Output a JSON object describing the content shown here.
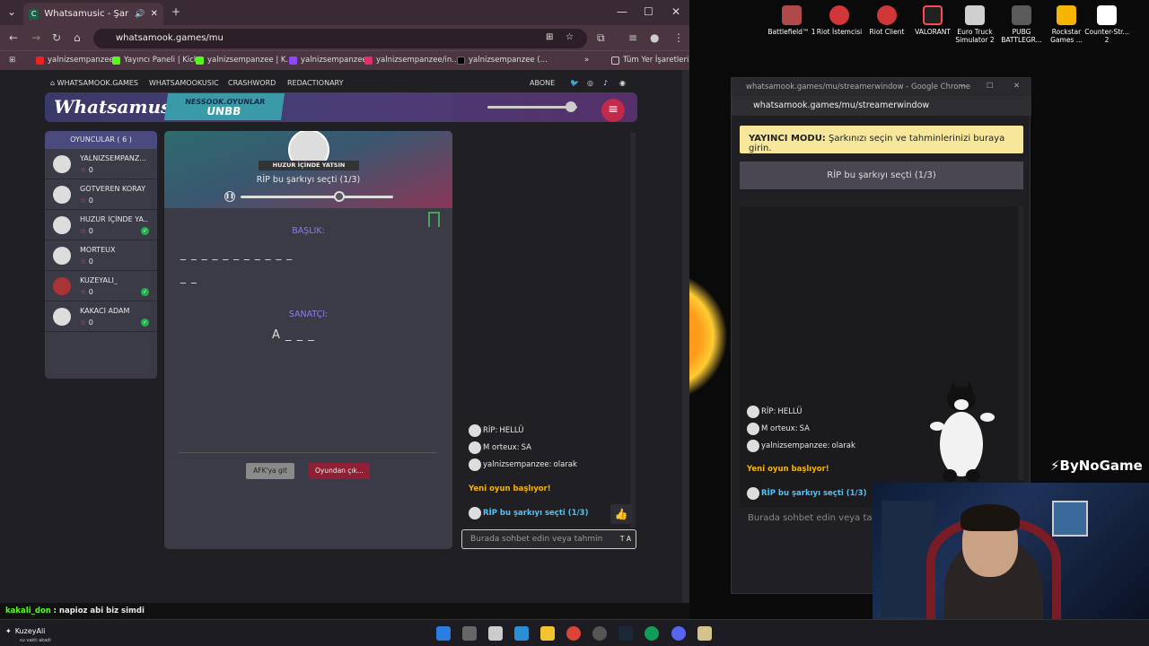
{
  "browser": {
    "tab_title": "Whatsamusic - Şarkıyı Tahm",
    "url": "whatsamook.games/mu",
    "bookmarks": [
      "yalnizsempanzee",
      "Yayıncı Paneli | Kick",
      "yalnizsempanzee | K...",
      "yalnizsempanzee",
      "yalnizsempanzee/in...",
      "yalnizsempanzee (...",
      "Tüm Yer İşaretleri"
    ]
  },
  "site": {
    "nav": [
      "WHATSAMOOK.GAMES",
      "WHATSAMOOKUSIC",
      "CRASHWORD",
      "REDACTIONARY"
    ],
    "abone": "ABONE",
    "logo": "Whatsamusic",
    "badge_top": "NESSOOK.OYUNLAR",
    "badge_bottom": "UNBB"
  },
  "players": {
    "header": "OYUNCULAR ( 6 )",
    "list": [
      {
        "name": "YALNIZSEMPANZ...",
        "score": "0",
        "done": false
      },
      {
        "name": "GÖTVEREN KORAY",
        "score": "0",
        "done": false
      },
      {
        "name": "HUZUR İÇİNDE YA...",
        "score": "0",
        "done": true
      },
      {
        "name": "MORTEUX",
        "score": "0",
        "done": false
      },
      {
        "name": "KUZEYALI_",
        "score": "0",
        "done": true
      },
      {
        "name": "KAKACI ADAM",
        "score": "0",
        "done": true
      }
    ]
  },
  "game": {
    "ribbon": "HUZUR İÇİNDE YATSIN",
    "picked": "RİP bu şarkıyı seçti (1/3)",
    "title_label": "BAŞLIK:",
    "title_dashes_1": "_ _ _ _ _ _ _ _ _ _ _",
    "title_dashes_2": "_ _",
    "artist_label": "SANATÇI:",
    "artist_hint": "A _ _ _",
    "afk_button": "AFK'ya git",
    "leave_button": "Oyundan çık..."
  },
  "chat": {
    "messages": [
      {
        "user": "RİP:",
        "text": "HELLÜ"
      },
      {
        "user": "M orteux:",
        "text": "SA"
      },
      {
        "user": "yalnizsempanzee:",
        "text": "olarak"
      }
    ],
    "system": "Yeni oyun başlıyor!",
    "picked": "RİP bu şarkıyı seçti (1/3)",
    "placeholder": "Burada sohbet edin veya tahmin",
    "input_icon": "T A"
  },
  "popup": {
    "title": "whatsamook.games/mu/streamerwindow - Google Chrome",
    "url": "whatsamook.games/mu/streamerwindow",
    "mode_bold": "YAYINCI MODU:",
    "mode_text": "Şarkınızı seçin ve tahminlerinizi buraya girin.",
    "bar": "RİP bu şarkıyı seçti (1/3)",
    "system": "Yeni oyun başlıyor!",
    "picked": "RİP bu şarkıyı seçti (1/3)",
    "placeholder": "Burada sohbet edin veya tah"
  },
  "desktop_icons": [
    "Battlefield™ 1",
    "Riot İstemcisi",
    "Riot Client",
    "VALORANT",
    "Euro Truck Simulator 2",
    "PUBG BATTLEGR...",
    "Rockstar Games ...",
    "Counter-Str... 2"
  ],
  "overlay": {
    "brand": "ByNoGame",
    "stream_user": "kakali_don",
    "stream_msg": ": napioz abi biz simdi",
    "streamer": "KuzeyAli",
    "streamer_sub": "su vakti akadi"
  }
}
